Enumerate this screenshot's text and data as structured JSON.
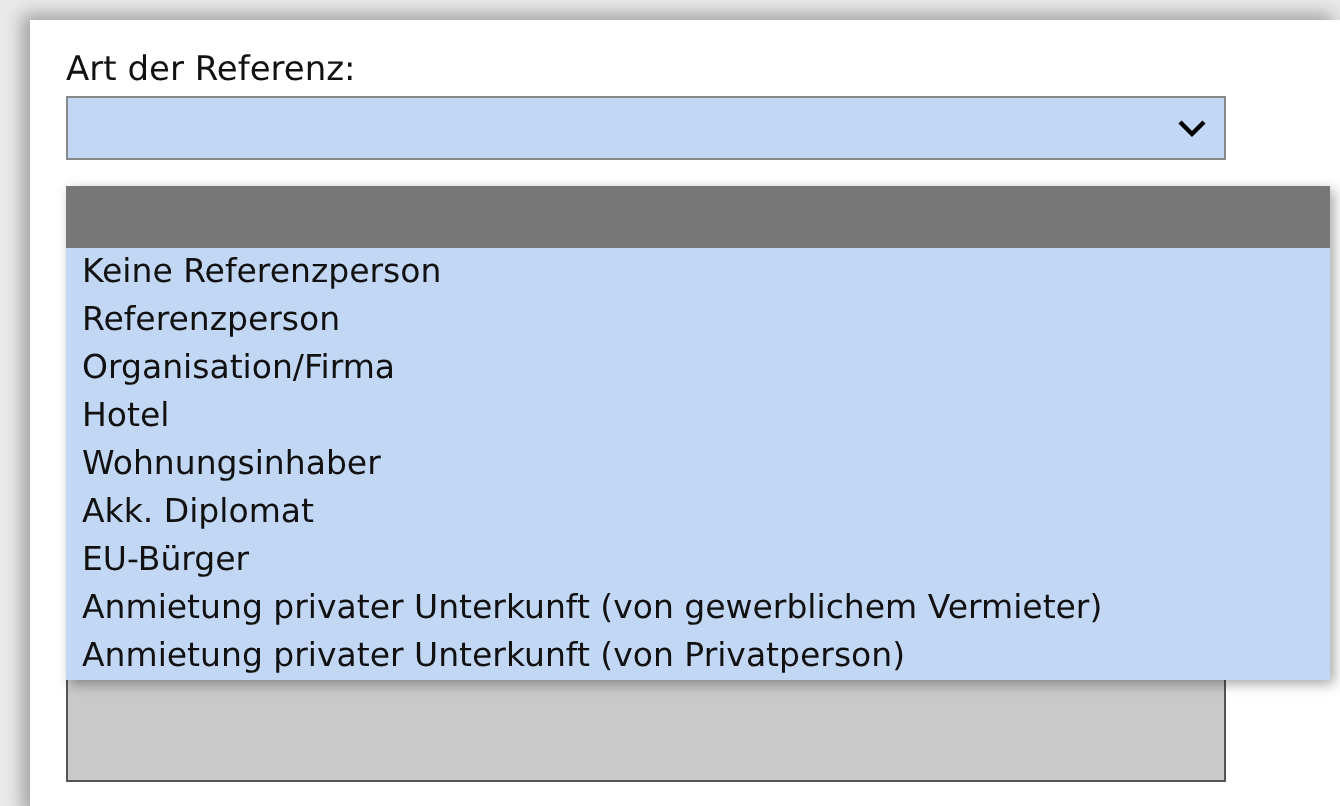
{
  "field": {
    "label": "Art der Referenz:"
  },
  "options": [
    {
      "selected": true
    },
    {
      "label": "Keine Referenzperson",
      "selected": false
    },
    {
      "label": "Referenzperson",
      "selected": false
    },
    {
      "label": "Organisation/Firma",
      "selected": false
    },
    {
      "label": "Hotel",
      "selected": false
    },
    {
      "label": "Wohnungsinhaber",
      "selected": false
    },
    {
      "label": "Akk. Diplomat",
      "selected": false
    },
    {
      "label": "EU-Bürger",
      "selected": false
    },
    {
      "label": "Anmietung privater Unterkunft (von gewerblichem Vermieter)",
      "selected": false
    },
    {
      "label": "Anmietung privater Unterkunft (von Privatperson)",
      "selected": false
    }
  ]
}
